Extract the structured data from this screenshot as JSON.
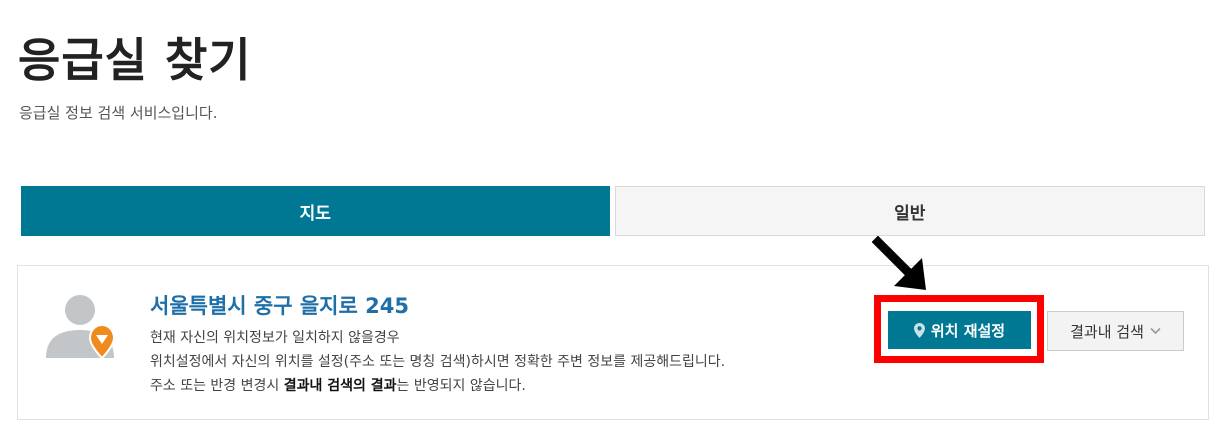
{
  "header": {
    "title": "응급실 찾기",
    "subtitle": "응급실 정보 검색 서비스입니다."
  },
  "tabs": [
    {
      "label": "지도",
      "active": true
    },
    {
      "label": "일반",
      "active": false
    }
  ],
  "location": {
    "address": "서울특별시 중구 을지로 245",
    "notes": {
      "line1": "현재 자신의 위치정보가 일치하지 않을경우",
      "line2": "위치설정에서 자신의 위치를 설정(주소 또는 명칭 검색)하시면 정확한 주변 정보를 제공해드립니다.",
      "line3_prefix": "주소 또는 반경 변경시 ",
      "line3_bold": "결과내 검색의 결과",
      "line3_suffix": "는 반영되지 않습니다."
    },
    "reset_button_label": "위치 재설정",
    "search_in_results_label": "결과내 검색"
  },
  "icons": {
    "avatar": "user-avatar-icon",
    "avatar_badge": "location-marker-icon",
    "reset_button": "map-pin-icon",
    "search_in_results": "chevron-down-icon",
    "annotation": "arrow-pointer-icon"
  },
  "colors": {
    "primary": "#007893",
    "address": "#1e6fa8",
    "badge": "#f08a1c",
    "highlight": "#ff0000"
  }
}
